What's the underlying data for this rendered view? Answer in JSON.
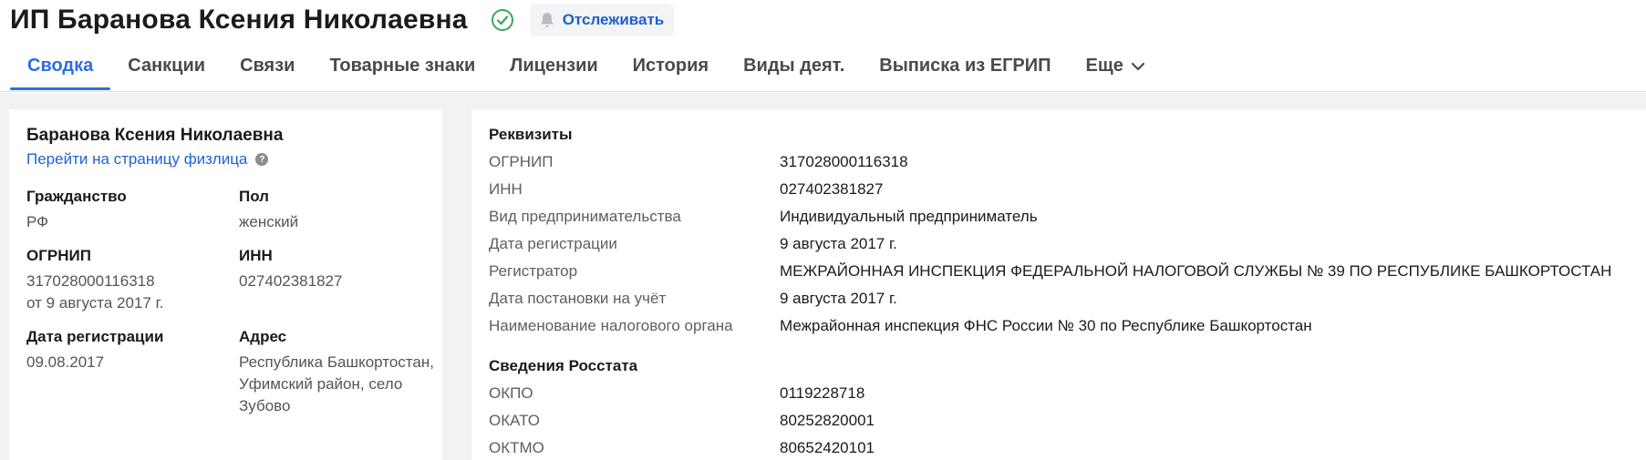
{
  "header": {
    "title": "ИП Баранова Ксения Николаевна",
    "follow_label": "Отслеживать"
  },
  "tabs": [
    {
      "label": "Сводка"
    },
    {
      "label": "Санкции"
    },
    {
      "label": "Связи"
    },
    {
      "label": "Товарные знаки"
    },
    {
      "label": "Лицензии"
    },
    {
      "label": "История"
    },
    {
      "label": "Виды деят."
    },
    {
      "label": "Выписка из ЕГРИП"
    },
    {
      "label": "Еще"
    }
  ],
  "summary": {
    "name": "Баранова Ксения Николаевна",
    "person_link": "Перейти на страницу физлица",
    "help_glyph": "?",
    "fields": {
      "citizenship": {
        "label": "Гражданство",
        "value": "РФ"
      },
      "gender": {
        "label": "Пол",
        "value": "женский"
      },
      "ogrnip": {
        "label": "ОГРНИП",
        "value": "317028000116318",
        "value2": "от 9 августа 2017 г."
      },
      "inn": {
        "label": "ИНН",
        "value": "027402381827"
      },
      "reg_date": {
        "label": "Дата регистрации",
        "value": "09.08.2017"
      },
      "address": {
        "label": "Адрес",
        "value": "Республика Башкортостан, Уфимский район, село Зубово"
      }
    }
  },
  "details": {
    "requisites_title": "Реквизиты",
    "requisites": [
      {
        "key": "ОГРНИП",
        "value": "317028000116318"
      },
      {
        "key": "ИНН",
        "value": "027402381827"
      },
      {
        "key": "Вид предпринимательства",
        "value": "Индивидуальный предприниматель"
      },
      {
        "key": "Дата регистрации",
        "value": "9 августа 2017 г."
      },
      {
        "key": "Регистратор",
        "value": "МЕЖРАЙОННАЯ ИНСПЕКЦИЯ ФЕДЕРАЛЬНОЙ НАЛОГОВОЙ СЛУЖБЫ № 39 ПО РЕСПУБЛИКЕ БАШКОРТОСТАН"
      },
      {
        "key": "Дата постановки на учёт",
        "value": "9 августа 2017 г."
      },
      {
        "key": "Наименование налогового органа",
        "value": "Межрайонная инспекция ФНС России № 30 по Республике Башкортостан"
      }
    ],
    "rosstat_title": "Сведения Росстата",
    "rosstat": [
      {
        "key": "ОКПО",
        "value": "0119228718"
      },
      {
        "key": "ОКАТО",
        "value": "80252820001"
      },
      {
        "key": "ОКТМО",
        "value": "80652420101"
      }
    ]
  },
  "colors": {
    "accent": "#2a6fe0",
    "link": "#1f62d6",
    "verified": "#3aa655",
    "background": "#f1f2f4"
  },
  "icons": {
    "verified": "check-circle-icon",
    "follow": "bell-icon",
    "more": "chevron-down-icon",
    "help": "question-icon"
  }
}
